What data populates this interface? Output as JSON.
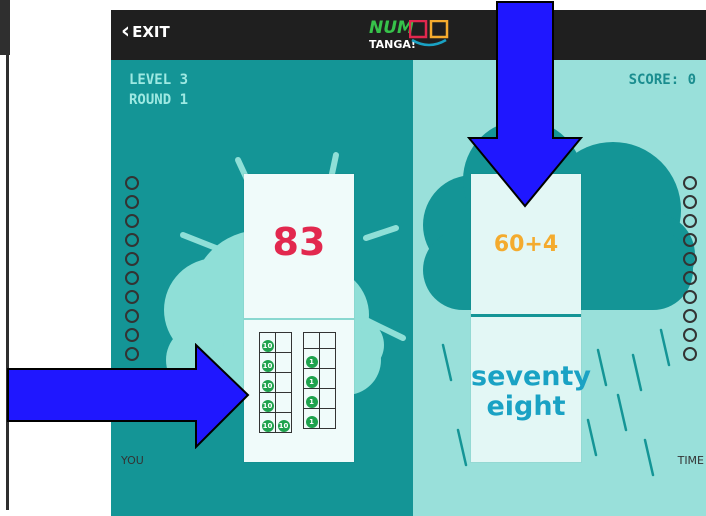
{
  "header": {
    "exit_label": "EXIT"
  },
  "logo": {
    "line1": "NUM",
    "line2": "TANGA!"
  },
  "hud": {
    "level": "LEVEL 3",
    "round": "ROUND 1",
    "score": "SCORE: 0"
  },
  "labels": {
    "you": "YOU",
    "time": "TIME"
  },
  "cards": {
    "target": "83",
    "sum": "60+4",
    "words": [
      "seventy",
      "eight"
    ]
  },
  "frames": {
    "chip_ten": "10",
    "chip_one": "1",
    "tens_filled_per_row": [
      1,
      1,
      1,
      1,
      2
    ],
    "ones_filled_per_row": [
      0,
      1,
      1,
      1,
      1
    ]
  },
  "progress": {
    "you_dots": 10,
    "time_dots": 10
  },
  "colors": {
    "left_bg": "#149596",
    "right_bg": "#99e0da",
    "target_red": "#e2284e",
    "sum_orange": "#f4ab2e",
    "words_blue": "#1aa2c4",
    "chip_green": "#1fa24d",
    "arrow_blue": "#1f17ff"
  }
}
